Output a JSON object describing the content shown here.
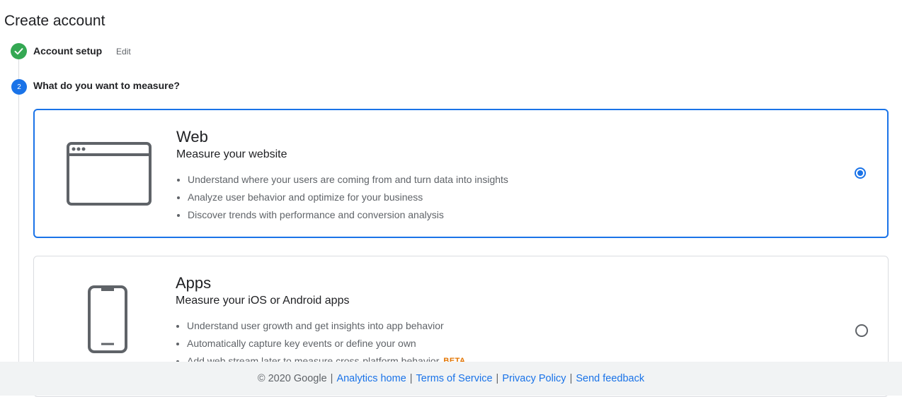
{
  "page": {
    "title": "Create account"
  },
  "steps": {
    "step1": {
      "label": "Account setup",
      "edit_label": "Edit",
      "icon": "check-icon",
      "status_color": "#34a853"
    },
    "step2": {
      "number": "2",
      "label": "What do you want to measure?",
      "accent": "#1a73e8"
    }
  },
  "options": {
    "web": {
      "title": "Web",
      "subtitle": "Measure your website",
      "icon": "browser-window-icon",
      "selected": true,
      "bullets": [
        "Understand where your users are coming from and turn data into insights",
        "Analyze user behavior and optimize for your business",
        "Discover trends with performance and conversion analysis"
      ]
    },
    "apps": {
      "title": "Apps",
      "subtitle": "Measure your iOS or Android apps",
      "icon": "mobile-phone-icon",
      "selected": false,
      "bullets": [
        "Understand user growth and get insights into app behavior",
        "Automatically capture key events or define your own",
        "Add web stream later to measure cross-platform behavior"
      ],
      "badge": "BETA"
    }
  },
  "footer": {
    "copyright": "© 2020 Google",
    "separator": "|",
    "links": {
      "analytics_home": "Analytics home",
      "terms": "Terms of Service",
      "privacy": "Privacy Policy",
      "feedback": "Send feedback"
    }
  },
  "colors": {
    "accent": "#1a73e8",
    "success": "#34a853",
    "beta": "#e37400"
  }
}
